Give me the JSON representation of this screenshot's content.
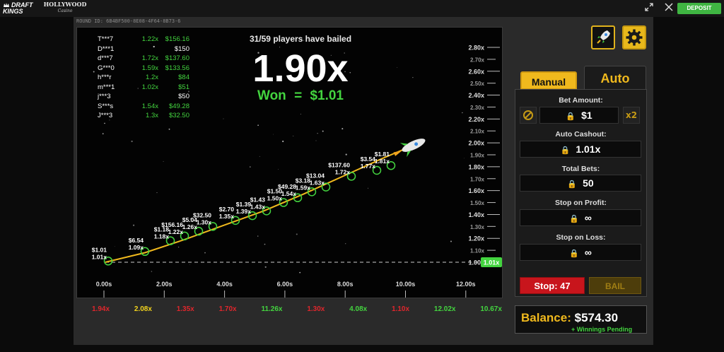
{
  "header": {
    "logo_main": "DRAFT KINGS",
    "logo_partner": "HOLLYWOOD",
    "logo_partner_sub": "Casino",
    "deposit_label": "DEPOSIT"
  },
  "round_id": "ROUND ID: 6B4BF500-8E08-4F64-8B73-6",
  "players": [
    {
      "name": "T***7",
      "multiplier": "1.22x",
      "amount": "$156.16",
      "won": true
    },
    {
      "name": "D***1",
      "multiplier": "",
      "amount": "$150",
      "won": false
    },
    {
      "name": "d***7",
      "multiplier": "1.72x",
      "amount": "$137.60",
      "won": true
    },
    {
      "name": "G***0",
      "multiplier": "1.59x",
      "amount": "$133.56",
      "won": true
    },
    {
      "name": "h***r",
      "multiplier": "1.2x",
      "amount": "$84",
      "won": true
    },
    {
      "name": "m***1",
      "multiplier": "1.02x",
      "amount": "$51",
      "won": true
    },
    {
      "name": "j***3",
      "multiplier": "",
      "amount": "$50",
      "won": false
    },
    {
      "name": "S***s",
      "multiplier": "1.54x",
      "amount": "$49.28",
      "won": true
    },
    {
      "name": "J***3",
      "multiplier": "1.3x",
      "amount": "$32.50",
      "won": true
    }
  ],
  "bailed_text": "31/59 players have bailed",
  "current_multiplier": "1.90x",
  "won_text": "Won  =  $1.01",
  "chart_data": {
    "type": "line",
    "y_ticks": [
      "2.80x",
      "2.70x",
      "2.60x",
      "2.50x",
      "2.40x",
      "2.30x",
      "2.20x",
      "2.10x",
      "2.00x",
      "1.90x",
      "1.80x",
      "1.70x",
      "1.60x",
      "1.50x",
      "1.40x",
      "1.30x",
      "1.20x",
      "1.10x",
      "1.00x"
    ],
    "x_ticks": [
      "0.00s",
      "2.00s",
      "4.00s",
      "6.00s",
      "8.00s",
      "10.00s",
      "12.00s"
    ],
    "ylim": [
      1.0,
      2.8
    ],
    "xlim": [
      0,
      13
    ],
    "cashout_line_label": "1.01x",
    "curve": {
      "x": [
        0,
        1.4,
        2.8,
        4.2,
        5.6,
        7.0,
        8.4,
        9.8,
        10.9
      ],
      "y": [
        1.0,
        1.08,
        1.19,
        1.31,
        1.43,
        1.57,
        1.72,
        1.87,
        1.98
      ]
    },
    "bail_points": [
      {
        "t": 0.1,
        "m": 1.01,
        "amount": "$1.01",
        "mult": "1.01x"
      },
      {
        "t": 1.4,
        "m": 1.09,
        "amount": "$6.54",
        "mult": "1.09x"
      },
      {
        "t": 2.3,
        "m": 1.18,
        "amount": "$1.18",
        "mult": "1.18x"
      },
      {
        "t": 2.8,
        "m": 1.22,
        "amount": "$156.16",
        "mult": "1.22x"
      },
      {
        "t": 3.3,
        "m": 1.26,
        "amount": "$5.04",
        "mult": "1.26x"
      },
      {
        "t": 3.8,
        "m": 1.3,
        "amount": "$32.50",
        "mult": "1.30x"
      },
      {
        "t": 4.6,
        "m": 1.35,
        "amount": "$2.70",
        "mult": "1.35x"
      },
      {
        "t": 5.2,
        "m": 1.39,
        "amount": "$1.39",
        "mult": "1.39x"
      },
      {
        "t": 5.7,
        "m": 1.43,
        "amount": "$1.43",
        "mult": "1.43x"
      },
      {
        "t": 6.3,
        "m": 1.5,
        "amount": "$1.50",
        "mult": "1.50x"
      },
      {
        "t": 6.8,
        "m": 1.54,
        "amount": "$49.28",
        "mult": "1.54x"
      },
      {
        "t": 7.3,
        "m": 1.59,
        "amount": "$3.18",
        "mult": "1.59x"
      },
      {
        "t": 7.8,
        "m": 1.63,
        "amount": "$13.04",
        "mult": "1.63x"
      },
      {
        "t": 8.7,
        "m": 1.72,
        "amount": "$137.60",
        "mult": "1.72x"
      },
      {
        "t": 9.6,
        "m": 1.77,
        "amount": "$3.54",
        "mult": "1.77x"
      },
      {
        "t": 10.1,
        "m": 1.81,
        "amount": "$1.81",
        "mult": "1.81x"
      }
    ]
  },
  "history": [
    {
      "value": "1.94x",
      "color": "#e0262c"
    },
    {
      "value": "2.08x",
      "color": "#f2d31d"
    },
    {
      "value": "1.35x",
      "color": "#e0262c"
    },
    {
      "value": "1.70x",
      "color": "#e0262c"
    },
    {
      "value": "11.26x",
      "color": "#43d43f"
    },
    {
      "value": "1.30x",
      "color": "#e0262c"
    },
    {
      "value": "4.08x",
      "color": "#43d43f"
    },
    {
      "value": "1.10x",
      "color": "#e0262c"
    },
    {
      "value": "12.02x",
      "color": "#43d43f"
    },
    {
      "value": "10.67x",
      "color": "#43d43f"
    }
  ],
  "tabs": {
    "manual": "Manual",
    "auto": "Auto"
  },
  "settings": {
    "bet_amount_label": "Bet Amount:",
    "bet_amount": "$1",
    "double_label": "x2",
    "auto_cashout_label": "Auto Cashout:",
    "auto_cashout": "1.01x",
    "total_bets_label": "Total Bets:",
    "total_bets": "50",
    "stop_profit_label": "Stop on Profit:",
    "stop_profit": "∞",
    "stop_loss_label": "Stop on Loss:",
    "stop_loss": "∞"
  },
  "stop_button": "Stop: 47",
  "bail_button": "BAIL",
  "balance": {
    "label": "Balance:",
    "value": "$574.30",
    "pending": "+ Winnings Pending"
  },
  "colors": {
    "accent": "#f0b91d",
    "win": "#43d43f",
    "loss": "#e0262c",
    "deposit": "#3fb542"
  }
}
